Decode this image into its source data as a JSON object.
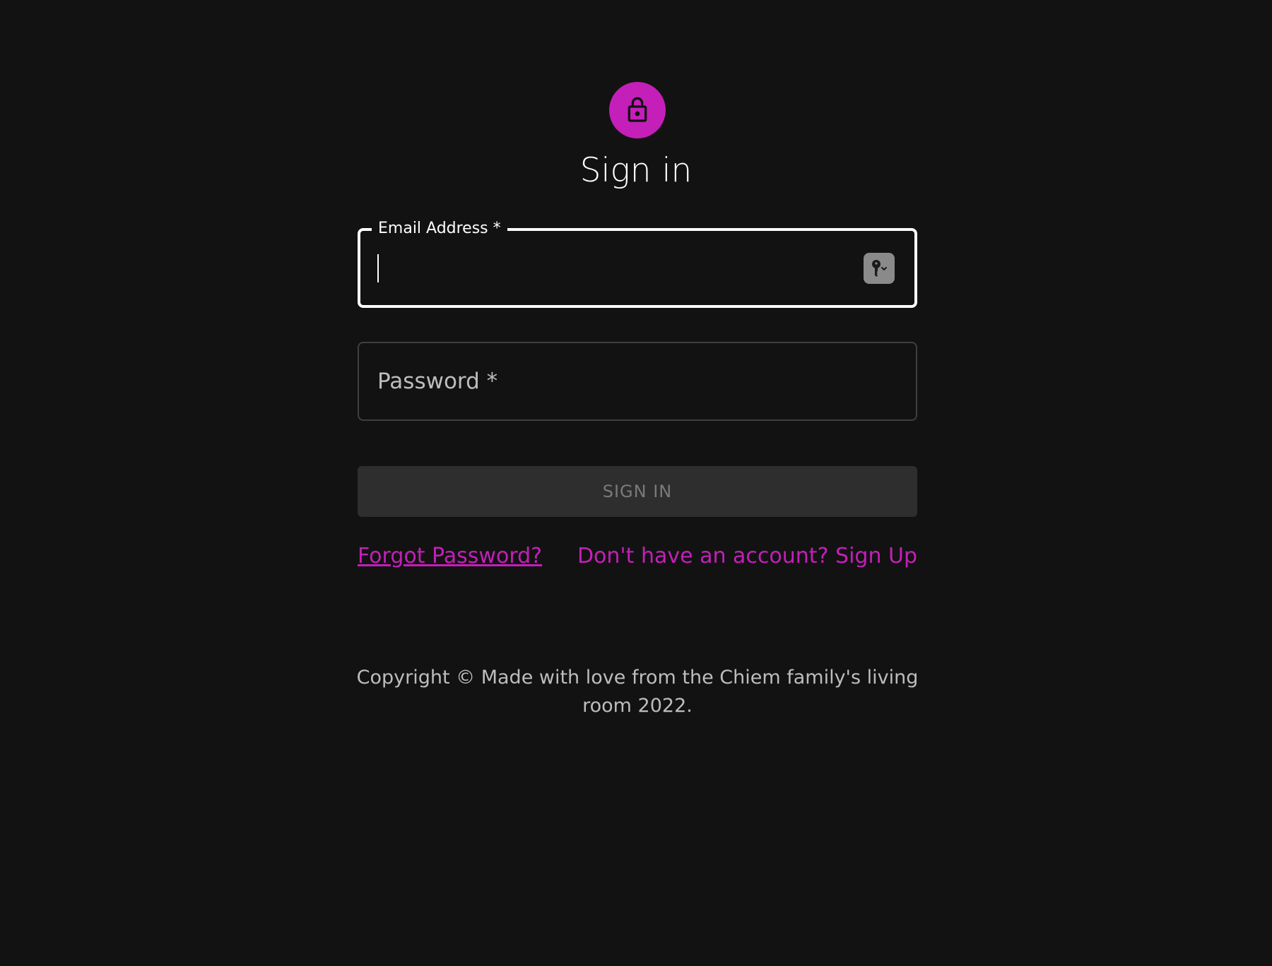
{
  "header": {
    "title": "Sign in",
    "avatar_icon": "lock-icon"
  },
  "form": {
    "email": {
      "label": "Email Address *",
      "value": "",
      "autofill_icon": "key-icon"
    },
    "password": {
      "placeholder": "Password *",
      "value": ""
    },
    "submit_label": "SIGN IN"
  },
  "links": {
    "forgot_password": "Forgot Password?",
    "sign_up": "Don't have an account? Sign Up"
  },
  "footer": {
    "copyright": "Copyright © Made with love from the Chiem family's living room 2022."
  },
  "colors": {
    "background": "#121212",
    "accent": "#c41fb8",
    "text": "#ffffff",
    "muted_text": "#bdbdbd",
    "button_disabled_bg": "#2e2e2e",
    "button_disabled_text": "#7a7a7a"
  }
}
